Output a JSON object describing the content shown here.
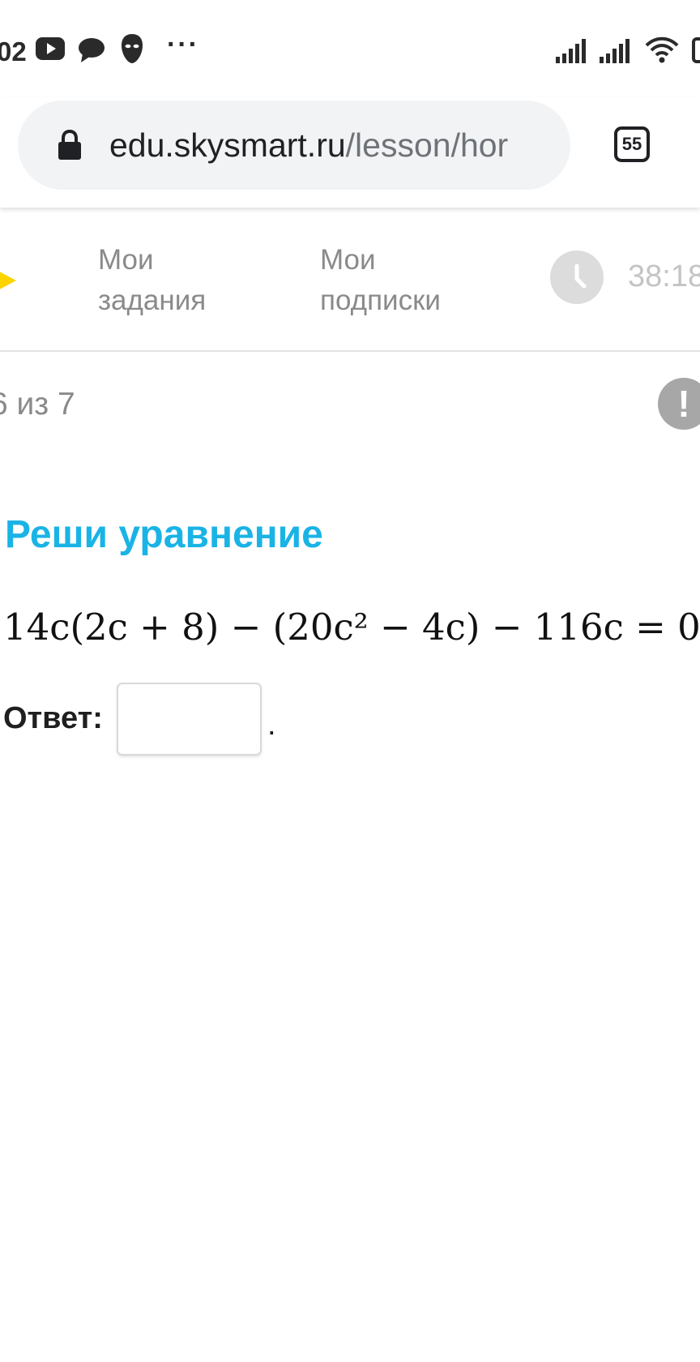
{
  "status_bar": {
    "time": "02",
    "icons": [
      "youtube-icon",
      "chat-bubble-icon",
      "mask-icon",
      "more-dots-icon",
      "signal-icon",
      "signal-icon",
      "wifi-icon",
      "battery-icon"
    ],
    "dots": "···"
  },
  "browser": {
    "url_domain": "edu.skysmart.ru",
    "url_path": "/lesson/hor",
    "tab_count": "55",
    "pill_color": "#f1f3f4"
  },
  "nav": {
    "logo_color": "#fdd400",
    "my_tasks": [
      "Мои",
      "задания"
    ],
    "my_subscriptions": [
      "Мои",
      "подписки"
    ],
    "timer": "38:18"
  },
  "task": {
    "progress": "6 из 7",
    "report_symbol": "!",
    "title": "Реши уравнение",
    "title_color": "#1ab3e6",
    "equation": "14c(2c + 8) − (20c² − 4c) − 116c = 0.",
    "answer_label": "Ответ:",
    "answer_value": "",
    "answer_suffix": "."
  }
}
